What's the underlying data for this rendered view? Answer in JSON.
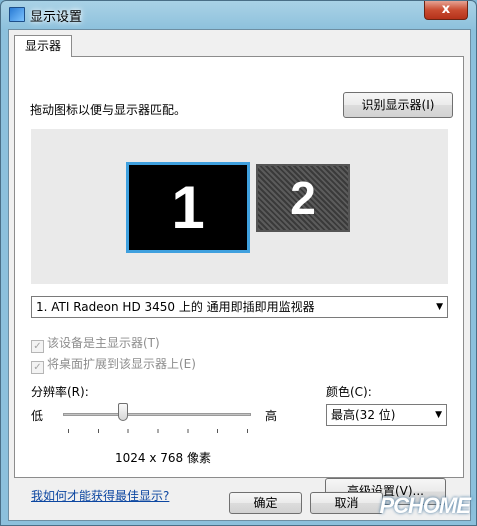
{
  "window": {
    "title": "显示设置",
    "close_glyph": "x"
  },
  "tab": {
    "label": "显示器"
  },
  "main": {
    "drag_hint": "拖动图标以便与显示器匹配。",
    "identify_button": "识别显示器(I)",
    "monitors": [
      {
        "number": "1",
        "selected": true
      },
      {
        "number": "2",
        "selected": false
      }
    ],
    "monitor_select": "1. ATI Radeon HD 3450 上的 通用即插即用监视器",
    "checkboxes": [
      {
        "label": "该设备是主显示器(T)",
        "checked": true,
        "enabled": false
      },
      {
        "label": "将桌面扩展到该显示器上(E)",
        "checked": true,
        "enabled": false
      }
    ],
    "resolution": {
      "label": "分辨率(R):",
      "low": "低",
      "high": "高",
      "value": "1024 x 768 像素",
      "slider_position": 0.31
    },
    "color": {
      "label": "颜色(C):",
      "value": "最高(32 位)"
    },
    "help_link": "我如何才能获得最佳显示?",
    "advanced_button": "高级设置(V)..."
  },
  "footer": {
    "ok_button": "确定",
    "cancel_button": "取消"
  },
  "watermark": "PCHOME",
  "colors": {
    "selected_monitor_border": "#3fa0de",
    "link": "#0d47a1"
  }
}
